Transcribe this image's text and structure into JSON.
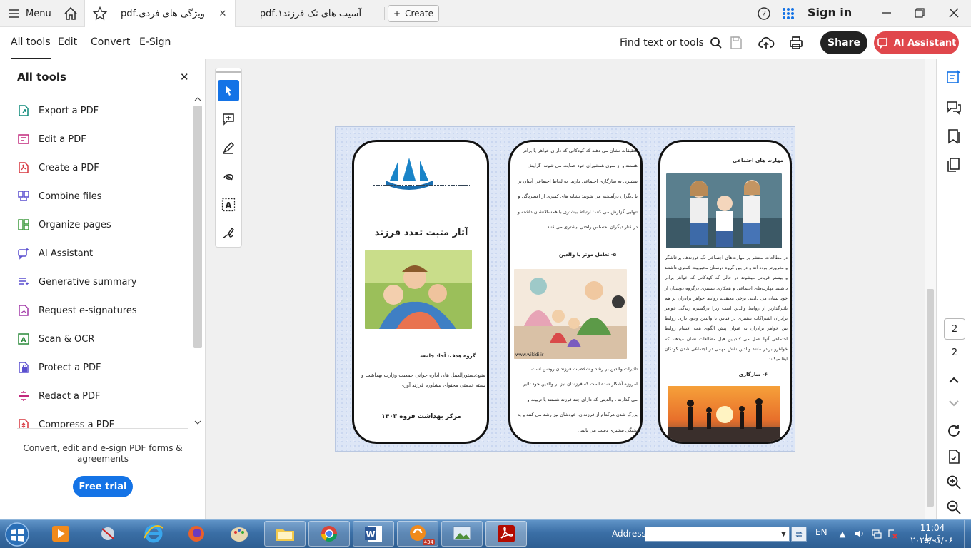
{
  "tabbar": {
    "menu_label": "Menu",
    "active_tab_title": "ویژگی های فردی.pdf",
    "inactive_tab_title": "آسیب های تک فرزند۱.pdf",
    "create_label": "Create",
    "signin_label": "Sign in"
  },
  "toolbar": {
    "tabs": [
      "All tools",
      "Edit",
      "Convert",
      "E-Sign"
    ],
    "find_label": "Find text or tools",
    "share_label": "Share",
    "ai_label": "AI Assistant"
  },
  "left_panel": {
    "title": "All tools",
    "items": [
      {
        "label": "Export a PDF",
        "icon": "export-pdf-icon",
        "color": "#0e8a7a"
      },
      {
        "label": "Edit a PDF",
        "icon": "edit-pdf-icon",
        "color": "#c2287d"
      },
      {
        "label": "Create a PDF",
        "icon": "create-pdf-icon",
        "color": "#d7373f"
      },
      {
        "label": "Combine files",
        "icon": "combine-files-icon",
        "color": "#5a4fcf"
      },
      {
        "label": "Organize pages",
        "icon": "organize-pages-icon",
        "color": "#3f9a3f"
      },
      {
        "label": "AI Assistant",
        "icon": "ai-assistant-icon",
        "color": "#5a4fcf"
      },
      {
        "label": "Generative summary",
        "icon": "generative-summary-icon",
        "color": "#5a4fcf"
      },
      {
        "label": "Request e-signatures",
        "icon": "request-esignatures-icon",
        "color": "#a23aa8"
      },
      {
        "label": "Scan & OCR",
        "icon": "scan-ocr-icon",
        "color": "#2a8a3a"
      },
      {
        "label": "Protect a PDF",
        "icon": "protect-pdf-icon",
        "color": "#5a4fcf"
      },
      {
        "label": "Redact a PDF",
        "icon": "redact-pdf-icon",
        "color": "#c2287d"
      },
      {
        "label": "Compress a PDF",
        "icon": "compress-pdf-icon",
        "color": "#d7373f"
      }
    ],
    "promo_text": "Convert, edit and e-sign PDF forms & agreements",
    "trial_label": "Free trial"
  },
  "document": {
    "panel1": {
      "title": "آثار مثبت تعدد فرزند",
      "target_group": "گروه هدف:       آحاد جامعه",
      "source": "منبع:دستورالعمل های اداره جوانی جمعیت وزارت بهداشت و بسته خدمتی محتوای مشاوره فرزند آوری",
      "footer": "مرکز بهداشت فروه ۱۴۰۳"
    },
    "panel2": {
      "text_top": "تحقیقات نشان می دهند که کودکانی که دارای خواهر یا برادر هستند و از سوی همشیران خود حمایت می شوند، گرایش بیشتری به سازگاری اجتماعی دارند: به لحاظ اجتماعی آسان تر با دیگران درآمیخته می شوند: نشانه های کمتری از افسردگی و تنهایی گزارش می کنند: ارتباط بیشتری با همسالانشان داشته و در کنار دیگران احساس راحتی بیشتری می کنند.",
      "heading": "۵-   تعامل موثر با والدین",
      "watermark": "www.wikidi.ir",
      "text_bottom": "تاثیرات والدین بر رشد و شخصیت فرزندان روشن است . امروزه آشکار شده است که فرزندان نیز بر والدین خود تاثیر می گذارند . والدینی که دارای چند فرزند هستند با تربیت و بزرگ شدن هرکدام از فرزندان، خودشان نیز رشد می کنند و به پختگی بیشتری دست می یابند ."
    },
    "panel3": {
      "heading": "مهارت های اجتماعی",
      "text": "در مطالعات منتشر بر مهارت‌های اجتماعی تک فرزندها، پرخاشگر و مغرورتر بوده اند و در بین گروه دوستان محبوبیت کمتری داشتند و بیشتر قربانی میشوند در حالی که کودکانی که خواهر برادر داشتند مهارت‌های اجتماعی و همکاری بیشتری درگروه دوستان از خود نشان می دادند. برخی معتقدند روابط خواهر برادران بر هم تاثیرگذارتر از روابط والدین است زیرا درگستره زندگی خواهر برادران اشتراکات بیشتری در قیاس با والدین وجود دارد. روابط بین خواهر برادران به عنوان پیش الگوی همه اقسام روابط اجتماعی آنها عمل می کندباین قبل مطالعات نشان میدهند که خواهرو برادر مانند والدین نقش مهمی در اجتماعی شدن کودکان ایفا میکنند.",
      "subheading": "۶-    سازگاری"
    }
  },
  "page_nav": {
    "current": "2",
    "total": "2"
  },
  "taskbar": {
    "address_label": "Address",
    "address_value": "",
    "language": "EN",
    "time": "11:04 ق.ظ",
    "date": "۲۰۲۵/۰۱/۰۶",
    "badge": "434"
  }
}
